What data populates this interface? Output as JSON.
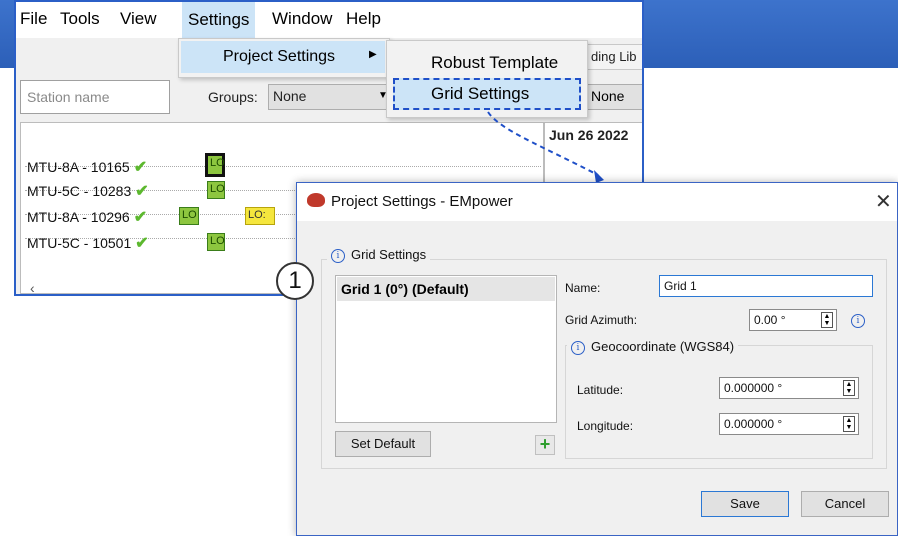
{
  "menubar": {
    "file": "File",
    "tools": "Tools",
    "view": "View",
    "settings": "Settings",
    "window": "Window",
    "help": "Help"
  },
  "settings_menu": {
    "project_settings": "Project Settings"
  },
  "project_submenu": {
    "robust_template": "Robust Template",
    "grid_settings": "Grid Settings"
  },
  "toolbar": {
    "station_placeholder": "Station name",
    "groups_label": "Groups:",
    "groups_value": "None",
    "right_select_value": "None",
    "tab_fragment": "ding Lib"
  },
  "timeline": {
    "date": "Jun 26 2022"
  },
  "stations": [
    {
      "label": "MTU-8A - 10165",
      "segments": [
        "LO"
      ]
    },
    {
      "label": "MTU-5C - 10283",
      "segments": [
        "LO"
      ]
    },
    {
      "label": "MTU-8A - 10296",
      "segments": [
        "LO",
        "LO:"
      ]
    },
    {
      "label": "MTU-5C - 10501",
      "segments": [
        "LO"
      ]
    }
  ],
  "scroll_arrow": "‹",
  "dialog": {
    "title": "Project Settings - EMpower",
    "group_title": "Grid Settings",
    "grids": [
      "Grid 1 (0°) (Default)"
    ],
    "set_default": "Set Default",
    "name_label": "Name:",
    "name_value": "Grid 1",
    "azimuth_label": "Grid Azimuth:",
    "azimuth_value": "0.00 °",
    "geo_title": "Geocoordinate (WGS84)",
    "latitude_label": "Latitude:",
    "latitude_value": "0.000000 °",
    "longitude_label": "Longitude:",
    "longitude_value": "0.000000 °",
    "save": "Save",
    "cancel": "Cancel"
  },
  "callout": {
    "number": "1"
  },
  "colors": {
    "banner": "#2c5fb8",
    "accent": "#2b5fc7",
    "highlight": "#cce4f7",
    "segment_green": "#8dc63f",
    "segment_yellow": "#f5e63d"
  },
  "icons": [
    "info-icon",
    "add-icon",
    "close-icon",
    "app-icon",
    "check-icon",
    "spin-icon"
  ]
}
